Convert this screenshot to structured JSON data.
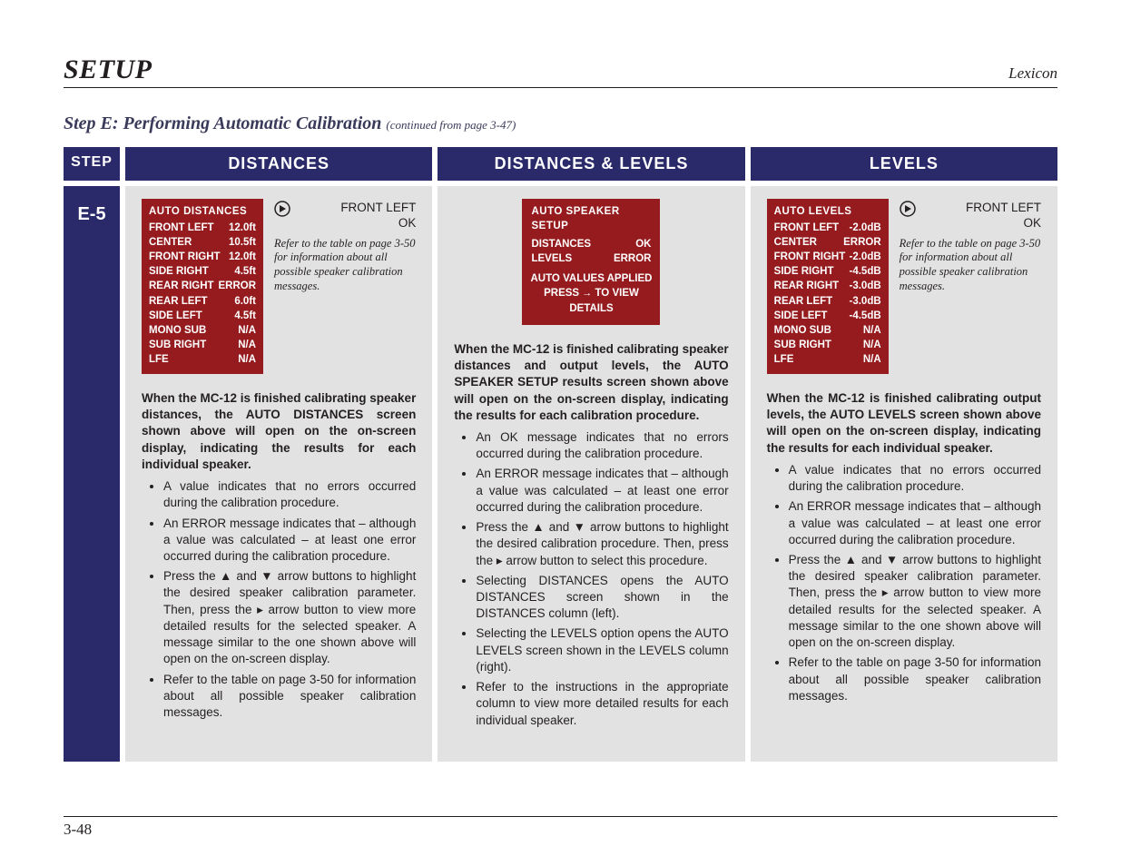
{
  "header": {
    "section": "SETUP",
    "brand": "Lexicon"
  },
  "subtitle": {
    "main": "Step E: Performing Automatic Calibration",
    "cont": "(continued from page 3-47)"
  },
  "footer": {
    "page": "3-48"
  },
  "table": {
    "heads": {
      "step": "STEP",
      "c1": "DISTANCES",
      "c2": "DISTANCES & LEVELS",
      "c3": "LEVELS"
    },
    "step_label": "E-5",
    "panels": {
      "distances": {
        "title": "AUTO DISTANCES",
        "rows": [
          [
            "FRONT LEFT",
            "12.0ft"
          ],
          [
            "CENTER",
            "10.5ft"
          ],
          [
            "FRONT RIGHT",
            "12.0ft"
          ],
          [
            "SIDE RIGHT",
            "4.5ft"
          ],
          [
            "REAR RIGHT",
            "ERROR"
          ],
          [
            "REAR LEFT",
            "6.0ft"
          ],
          [
            "SIDE LEFT",
            "4.5ft"
          ],
          [
            "MONO SUB",
            "N/A"
          ],
          [
            "SUB RIGHT",
            "N/A"
          ],
          [
            "LFE",
            "N/A"
          ]
        ],
        "callout": {
          "head": "FRONT LEFT",
          "val": "OK",
          "note": "Refer to the table on page 3-50 for information about all possible speaker calibration messages."
        }
      },
      "combo": {
        "title": "AUTO SPEAKER SETUP",
        "rows": [
          [
            "DISTANCES",
            "OK"
          ],
          [
            "LEVELS",
            "ERROR"
          ]
        ],
        "msg1": "AUTO VALUES APPLIED",
        "msg2a": "PRESS ",
        "msg2b": " TO VIEW",
        "msg3": "DETAILS"
      },
      "levels": {
        "title": "AUTO LEVELS",
        "rows": [
          [
            "FRONT LEFT",
            "-2.0dB"
          ],
          [
            "CENTER",
            "ERROR"
          ],
          [
            "FRONT RIGHT",
            "-2.0dB"
          ],
          [
            "SIDE RIGHT",
            "-4.5dB"
          ],
          [
            "REAR RIGHT",
            "-3.0dB"
          ],
          [
            "REAR LEFT",
            "-3.0dB"
          ],
          [
            "SIDE LEFT",
            "-4.5dB"
          ],
          [
            "MONO SUB",
            "N/A"
          ],
          [
            "SUB RIGHT",
            "N/A"
          ],
          [
            "LFE",
            "N/A"
          ]
        ],
        "callout": {
          "head": "FRONT LEFT",
          "val": "OK",
          "note": "Refer to the table on page 3-50 for information about all possible speaker calibration messages."
        }
      }
    },
    "col1": {
      "lead": "When the MC-12 is finished calibrating speaker distances, the AUTO DISTANCES screen shown above will open on the on-screen display, indicating the results for each individual speaker.",
      "bullets": [
        "A value indicates that no errors occurred during the calibration procedure.",
        "An ERROR message indicates that – although a value was calculated – at least one error occurred during the calibration procedure.",
        "Press the ▲ and ▼ arrow buttons to highlight the desired speaker calibration parameter. Then, press the ▸ arrow button to view more detailed results for the selected speaker. A message similar to the one shown above will open on the on-screen display.",
        "Refer to the table on page 3-50 for information about all possible speaker calibration messages."
      ]
    },
    "col2": {
      "lead": "When the MC-12 is finished calibrating speaker distances and output levels, the AUTO SPEAKER SETUP results screen shown above will open on the on-screen display, indicating the results for each calibration procedure.",
      "bullets": [
        "An OK message indicates that no errors occurred during the calibration procedure.",
        "An ERROR message indicates that – although a value was calculated – at least one error occurred during the calibration procedure.",
        "Press the ▲ and ▼ arrow buttons to highlight the desired calibration procedure. Then, press the ▸ arrow button to select this procedure.",
        "Selecting DISTANCES opens the AUTO DISTANCES screen shown in the DISTANCES column (left).",
        "Selecting the LEVELS option opens the AUTO LEVELS screen shown in the LEVELS column (right).",
        "Refer to the instructions in the appropriate column to view more detailed results for each individual speaker."
      ]
    },
    "col3": {
      "lead": "When the MC-12 is finished calibrating output levels, the AUTO LEVELS screen shown above will open on the on-screen display, indicating the results for each individual speaker.",
      "bullets": [
        "A value indicates that no errors occurred during the calibration procedure.",
        "An ERROR message indicates that – although a value was calculated – at least one error occurred during the calibration procedure.",
        "Press the ▲ and ▼ arrow buttons to highlight the desired speaker calibration parameter. Then, press the ▸ arrow button to view more detailed results for the selected speaker. A message similar to the one shown above will open on the on-screen display.",
        "Refer to the table on page 3-50 for information about all possible speaker calibration messages."
      ]
    }
  }
}
